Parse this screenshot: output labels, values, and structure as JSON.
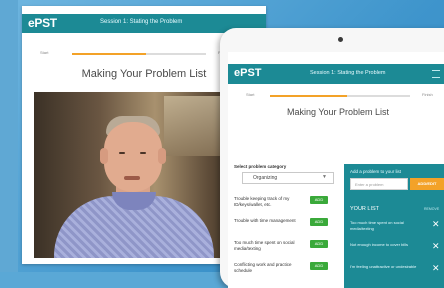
{
  "back_screen": {
    "logo": "ePST",
    "session_title": "Session 1: Stating the Problem",
    "progress_left": "Start",
    "progress_right": "Finish",
    "progress_fraction": 0.55,
    "page_title": "Making Your Problem List"
  },
  "tablet_screen": {
    "logo": "ePST",
    "session_title": "Session 1: Stating the Problem",
    "progress_left": "Start",
    "progress_right": "Finish",
    "progress_fraction": 0.55,
    "page_title": "Making Your Problem List",
    "select_label": "Select problem category",
    "select_value": "Organizing",
    "problems": [
      {
        "text": "Trouble keeping track of my ID/keys/wallet, etc.",
        "button": "ADD"
      },
      {
        "text": "Trouble with time management",
        "button": "ADD"
      },
      {
        "text": "Too much time spent on social media/texting",
        "button": "ADD"
      },
      {
        "text": "Conflicting work and practice schedule",
        "button": "ADD"
      }
    ],
    "add_panel": {
      "label": "Add a problem to your list",
      "input_placeholder": "Enter a problem",
      "add_button": "ADD/EDIT",
      "your_list_label": "YOUR LIST",
      "remove_label": "REMOVE",
      "items": [
        {
          "text": "Too much time spent on social media/texting"
        },
        {
          "text": "Not enough income to cover bills"
        },
        {
          "text": "I'm feeling unattractive or undesirable"
        }
      ]
    }
  },
  "colors": {
    "teal_header": "#1c8a95",
    "orange_accent": "#f3a228",
    "green_button": "#3aa93a",
    "background_blue": "#4a9fd2"
  }
}
